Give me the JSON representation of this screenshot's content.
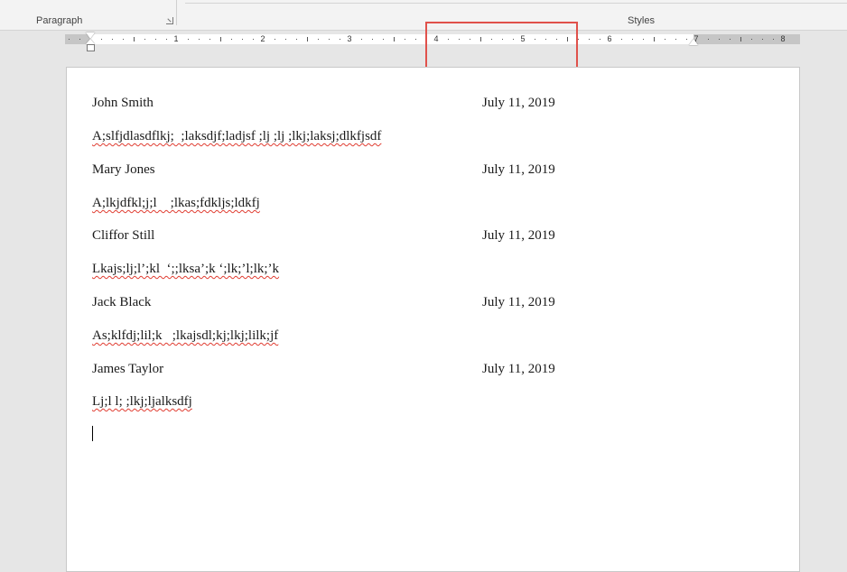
{
  "ribbon": {
    "paragraph_label": "Paragraph",
    "styles_label": "Styles"
  },
  "ruler": {
    "numbers": [
      "1",
      "2",
      "3",
      "4",
      "5",
      "6",
      "7",
      "8"
    ]
  },
  "document": {
    "entries": [
      {
        "name": "John Smith",
        "date": "July 11, 2019",
        "note": "A;slfjdlasdflkj;  ;laksdjf;ladjsf ;lj ;lj ;lkj;laksj;dlkfjsdf"
      },
      {
        "name": "Mary Jones",
        "date": "July 11, 2019",
        "note": "A;lkjdfkl;j;l    ;lkas;fdkljs;ldkfj"
      },
      {
        "name": "Cliffor Still",
        "date": "July 11, 2019",
        "note": "Lkajs;lj;l’;kl  ‘;;lksa’;k ‘;lk;’l;lk;’k"
      },
      {
        "name": "Jack Black",
        "date": "July 11, 2019",
        "note": "As;klfdj;lil;k   ;lkajsdl;kj;lkj;lilk;jf"
      },
      {
        "name": "James Taylor",
        "date": "July 11, 2019",
        "note": "Lj;l l; ;lkj;ljalksdfj"
      }
    ]
  },
  "colors": {
    "highlight": "#e0514b",
    "spellcheck": "#e03c31"
  }
}
